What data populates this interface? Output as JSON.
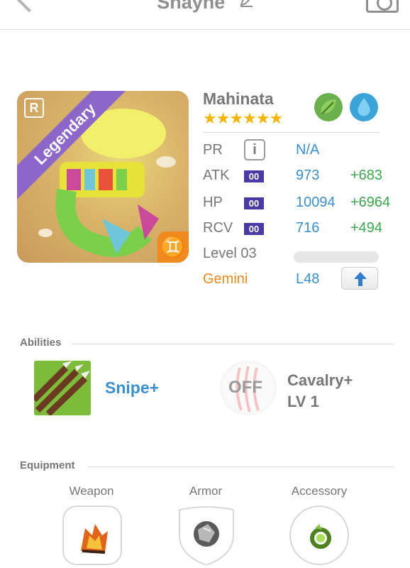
{
  "header": {
    "title": "Shayne",
    "edit_icon": "pencil-icon",
    "back_icon": "chevron-left-icon",
    "camera_icon": "camera-icon"
  },
  "card": {
    "rarity_label": "Legendary",
    "rarity_badge": "R",
    "name": "Mahinata",
    "stars": "★★★★★★",
    "star_count": 6,
    "elements": [
      "leaf-icon",
      "water-drop-icon"
    ],
    "zodiac_symbol": "♊"
  },
  "stats": {
    "pr": {
      "label": "PR",
      "info": "i",
      "value": "N/A"
    },
    "atk": {
      "label": "ATK",
      "tag": "00",
      "value": "973",
      "bonus": "+683"
    },
    "hp": {
      "label": "HP",
      "tag": "00",
      "value": "10094",
      "bonus": "+6964"
    },
    "rcv": {
      "label": "RCV",
      "tag": "00",
      "value": "716",
      "bonus": "+494"
    },
    "level": {
      "label": "Level 03",
      "progress": 0.0
    },
    "zodiac": {
      "label": "Gemini",
      "value": "L48",
      "button_icon": "arrow-up-icon"
    }
  },
  "abilities": {
    "heading": "Abilities",
    "items": [
      {
        "name": "Snipe+",
        "icon": "arrows-icon"
      },
      {
        "status": "OFF",
        "name_line1": "Cavalry+",
        "name_line2": "LV 1",
        "icon": "claw-icon"
      }
    ]
  },
  "equipment": {
    "heading": "Equipment",
    "slots": [
      {
        "label": "Weapon",
        "icon": "fire-weapon-icon"
      },
      {
        "label": "Armor",
        "icon": "armor-gem-icon"
      },
      {
        "label": "Accessory",
        "icon": "green-ring-icon"
      }
    ]
  },
  "colors": {
    "accent_blue": "#3a8fd1",
    "bonus_green": "#3aa84b",
    "legendary_purple": "#8c66c8",
    "zodiac_orange": "#f08a1a",
    "tag_purple": "#4b3aa6"
  }
}
